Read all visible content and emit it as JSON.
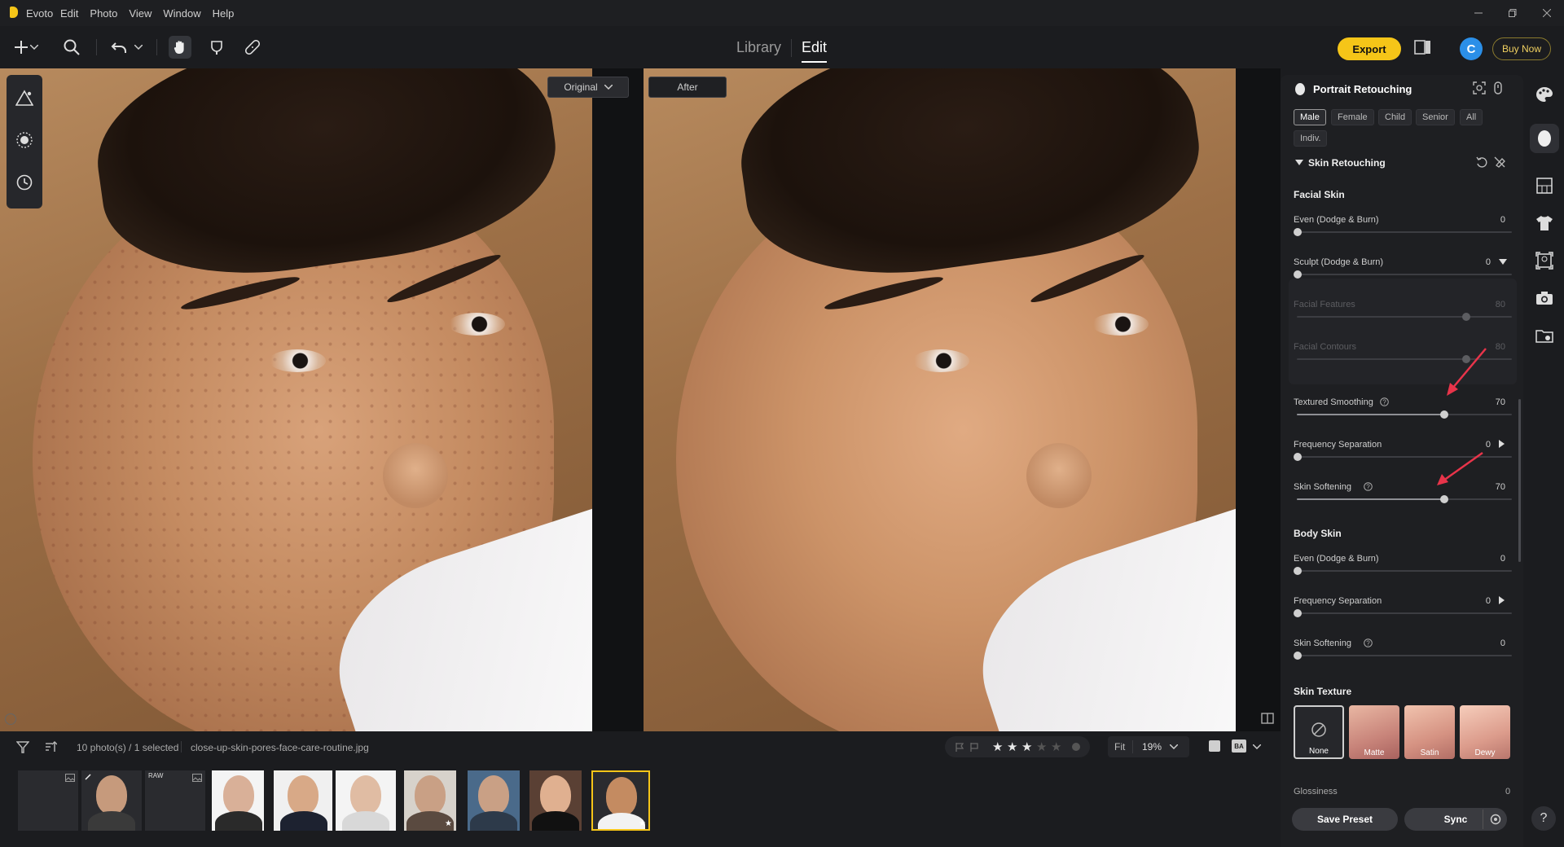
{
  "app": {
    "name": "Evoto",
    "menu": [
      "Edit",
      "Photo",
      "View",
      "Window",
      "Help"
    ]
  },
  "toolbar": {
    "tabs": {
      "library": "Library",
      "edit": "Edit"
    },
    "export_label": "Export",
    "avatar_letter": "C",
    "buy_now_label": "Buy Now"
  },
  "canvas": {
    "original_dropdown": "Original",
    "after_label": "After"
  },
  "filmstrip": {
    "selection_info": "10 photo(s) / 1 selected",
    "filename": "close-up-skin-pores-face-care-routine.jpg",
    "stars_filled": 3,
    "stars_total": 5,
    "fit_label": "Fit",
    "zoom": "19%",
    "raw_badge": "RAW"
  },
  "panel": {
    "title": "Portrait Retouching",
    "presets": [
      "Male",
      "Female",
      "Child",
      "Senior",
      "All",
      "Indiv."
    ],
    "active_preset": "Male",
    "group_title": "Skin Retouching",
    "facial_skin_title": "Facial Skin",
    "sliders_facial": [
      {
        "label": "Even (Dodge & Burn)",
        "value": "0"
      },
      {
        "label": "Sculpt (Dodge & Burn)",
        "value": "0"
      },
      {
        "label": "Facial Features",
        "value": "80"
      },
      {
        "label": "Facial Contours",
        "value": "80"
      },
      {
        "label": "Textured Smoothing",
        "value": "70"
      },
      {
        "label": "Frequency Separation",
        "value": "0"
      },
      {
        "label": "Skin Softening",
        "value": "70"
      }
    ],
    "body_skin_title": "Body Skin",
    "sliders_body": [
      {
        "label": "Even (Dodge & Burn)",
        "value": "0"
      },
      {
        "label": "Frequency Separation",
        "value": "0"
      },
      {
        "label": "Skin Softening",
        "value": "0"
      }
    ],
    "skin_texture_title": "Skin Texture",
    "textures": [
      "None",
      "Matte",
      "Satin",
      "Dewy"
    ],
    "glossiness_label": "Glossiness",
    "glossiness_value": "0",
    "save_preset_label": "Save Preset",
    "sync_label": "Sync"
  },
  "help_label": "?",
  "colors": {
    "accent": "#f5c518",
    "panel_bg": "#1e1f22",
    "avatar": "#2b8fe8"
  }
}
